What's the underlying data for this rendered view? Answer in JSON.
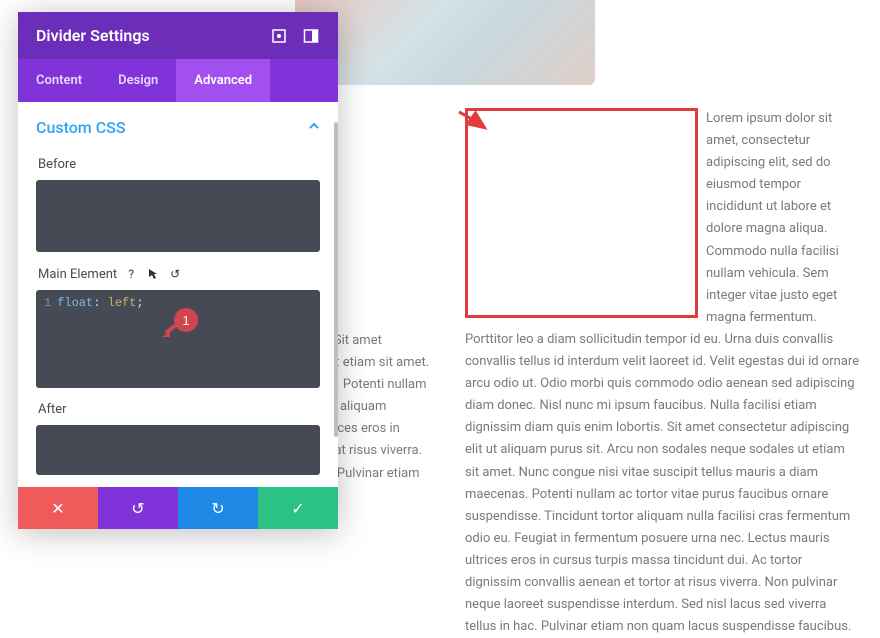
{
  "panel": {
    "title": "Divider Settings",
    "tabs": {
      "content": "Content",
      "design": "Design",
      "advanced": "Advanced"
    },
    "section_title": "Custom CSS",
    "labels": {
      "before": "Before",
      "main": "Main Element",
      "after": "After"
    },
    "main_code_line": "float: left;",
    "badge_number": "1"
  },
  "icons": {
    "expand": "expand",
    "collapse_side": "collapse",
    "chevron_up": "^",
    "help": "?",
    "cursor": "↖",
    "reset": "↺",
    "cancel": "✕",
    "undo": "↺",
    "redo": "↻",
    "save": "✓"
  },
  "right_paragraph": "Lorem ipsum dolor sit amet, consectetur adipiscing elit, sed do eiusmod tempor incididunt ut labore et dolore magna aliqua. Commodo nulla facilisi nullam vehicula. Sem integer vitae justo eget magna fermentum. Porttitor leo a diam sollicitudin tempor id eu. Urna duis convallis convallis tellus id interdum velit laoreet id. Velit egestas dui id ornare arcu odio ut. Odio morbi quis commodo odio aenean sed adipiscing diam donec. Nisl nunc mi ipsum faucibus. Nulla facilisi etiam dignissim diam quis enim lobortis. Sit amet consectetur adipiscing elit ut aliquam purus sit. Arcu non sodales neque sodales ut etiam sit amet. Nunc congue nisi vitae suscipit tellus mauris a diam maecenas. Potenti nullam ac tortor vitae purus faucibus ornare suspendisse. Tincidunt tortor aliquam nulla facilisi cras fermentum odio eu. Feugiat in fermentum posuere urna nec. Lectus mauris ultrices eros in cursus turpis massa tincidunt dui. Ac tortor dignissim convallis aenean et tortor at risus viverra. Non pulvinar neque laoreet suspendisse interdum. Sed nisl lacus sed viverra tellus in hac. Pulvinar etiam non quam lacus suspendisse faucibus.",
  "bg_paragraph": "Nulla facilisi etiam dignissim diam quis enim lobortis. Sit amet consectetur adipiscing elit ut aliquam purus sit. Arcu ut etiam sit amet. Nunc congue nisi vitae tellus mauris a diam maecenas. Potenti nullam ac tortor faucibus ornare suspendisse. Tincidunt tortor aliquam fermentum odio eu. Feugiat in fermentum posuere ultrices eros in cursus turpis massa tincidunt dui. Ac aenean et tortor at risus viverra. Non laoreet suspendisse interdum. Sed nisl lacus sed. Pulvinar etiam non quam lacus suspendisse faucibus."
}
